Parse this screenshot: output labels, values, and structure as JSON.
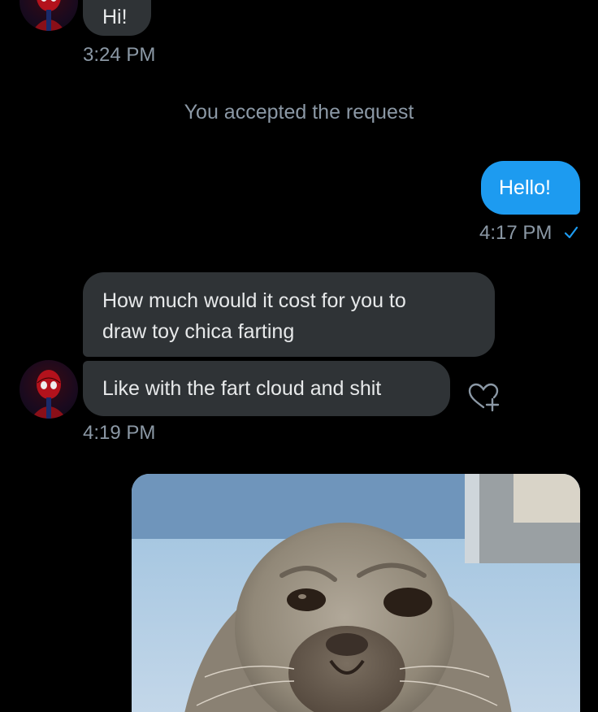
{
  "conversation": {
    "messages_top": {
      "hi_text": "Hi!",
      "hi_time": "3:24 PM"
    },
    "system_note": "You accepted the request",
    "outgoing": {
      "text": "Hello!",
      "time": "4:17 PM",
      "status_icon": "check-icon"
    },
    "incoming_group": {
      "bubble1_line1": "How much would it cost for you to",
      "bubble1_line2": "draw toy chica farting",
      "bubble2": "Like with the fart cloud and shit",
      "time": "4:19 PM",
      "react_icon": "heart-plus-icon"
    },
    "media": {
      "icon": "seal-photo"
    }
  },
  "colors": {
    "background": "#000000",
    "incoming_bubble": "#2f3336",
    "outgoing_bubble": "#1d9bf0",
    "muted_text": "#8b98a5"
  }
}
